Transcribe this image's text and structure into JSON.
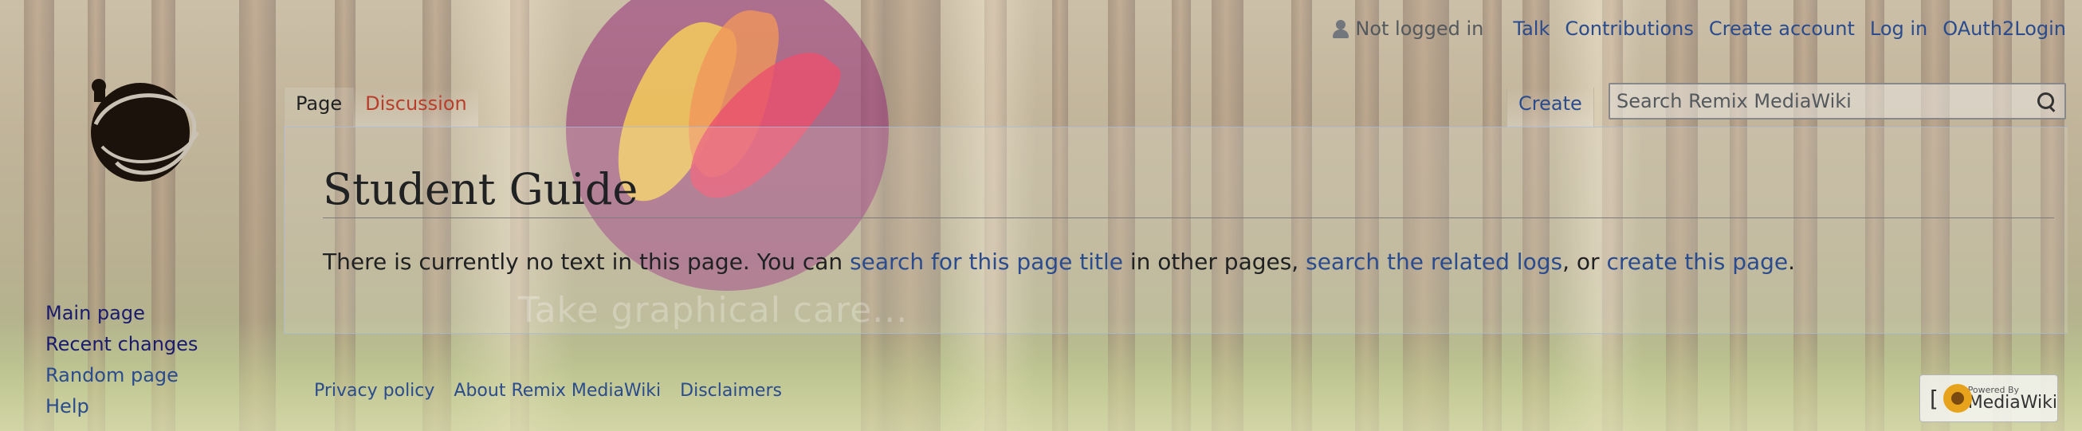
{
  "watermark": {
    "text": "Take graphical care..."
  },
  "personal_tools": {
    "status": "Not logged in",
    "links": [
      "Talk",
      "Contributions",
      "Create account",
      "Log in",
      "OAuth2Login"
    ]
  },
  "sidebar": {
    "items": [
      "Main page",
      "Recent changes",
      "Random page",
      "Help"
    ]
  },
  "tabs": {
    "page": "Page",
    "discussion": "Discussion",
    "create": "Create"
  },
  "search": {
    "placeholder": "Search Remix MediaWiki"
  },
  "content": {
    "title": "Student Guide",
    "text_1": "There is currently no text in this page. You can ",
    "link_1": "search for this page title",
    "text_2": " in other pages, ",
    "link_2": "search the related logs",
    "text_3": ", or ",
    "link_3": "create this page",
    "text_4": "."
  },
  "footer": {
    "links": [
      "Privacy policy",
      "About Remix MediaWiki",
      "Disclaimers"
    ],
    "powered_small": "Powered By",
    "powered_big": "MediaWiki"
  },
  "colors": {
    "link": "#2a4b8d",
    "new_link": "#ba3d2c",
    "text": "#202122"
  }
}
